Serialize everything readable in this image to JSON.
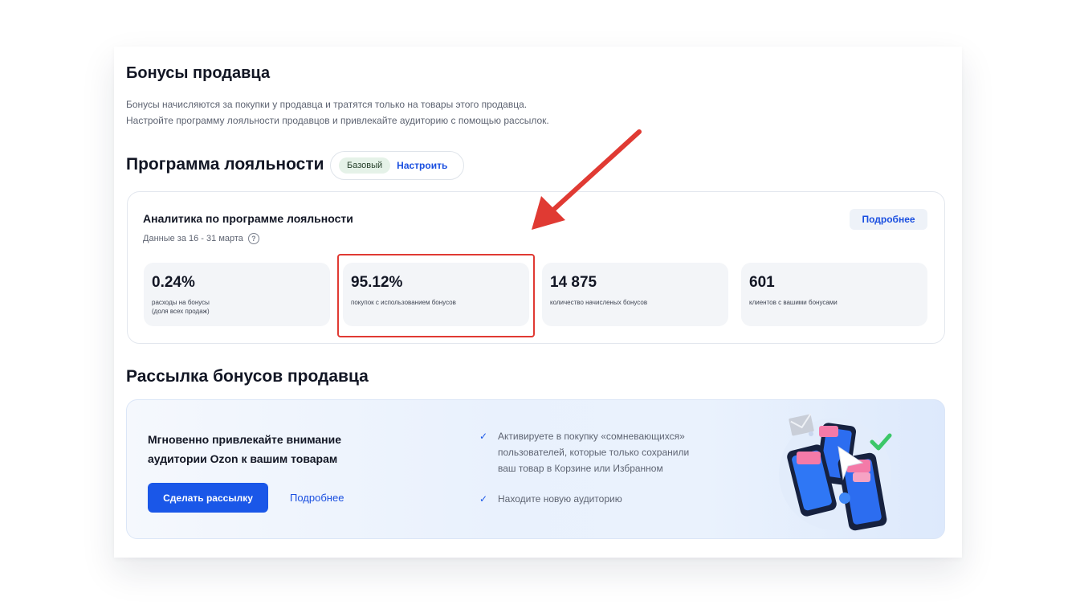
{
  "header": {
    "title": "Бонусы продавца",
    "desc_line1": "Бонусы начисляются за покупки у продавца и тратятся только на товары этого продавца.",
    "desc_line2": "Настройте программу лояльности продавцов и привлекайте аудиторию с помощью рассылок."
  },
  "loyalty": {
    "title": "Программа лояльности",
    "badge": "Базовый",
    "configure_link": "Настроить"
  },
  "analytics": {
    "title": "Аналитика по программе лояльности",
    "subtitle": "Данные за 16 - 31 марта",
    "help_icon": "question-circle-icon",
    "details_button": "Подробнее",
    "stats": [
      {
        "value": "0.24%",
        "label_line1": "расходы на бонусы",
        "label_line2": "(доля всех продаж)"
      },
      {
        "value": "95.12%",
        "label_line1": "покупок с использованием бонусов",
        "label_line2": ""
      },
      {
        "value": "14 875",
        "label_line1": "количество начисленых бонусов",
        "label_line2": ""
      },
      {
        "value": "601",
        "label_line1": "клиентов с вашими бонусами",
        "label_line2": ""
      }
    ]
  },
  "mailing": {
    "title": "Рассылка бонусов продавца",
    "headline_line1": "Мгновенно привлекайте внимание",
    "headline_line2": "аудитории Ozon к вашим товарам",
    "primary_button": "Сделать рассылку",
    "secondary_link": "Подробнее",
    "bullets": [
      {
        "line1": "Активируете в покупку «сомневающихся»",
        "line2": "пользователей, которые только сохранили",
        "line3": "ваш товар в Корзине или Избранном"
      },
      {
        "line1": "Находите новую аудиторию"
      }
    ],
    "illustration_icon": "phones-with-coupons-icon"
  },
  "colors": {
    "accent": "#1a57e8",
    "link": "#1a4fe0",
    "highlight": "#e03a33",
    "badge_bg": "#e5f2e8"
  }
}
